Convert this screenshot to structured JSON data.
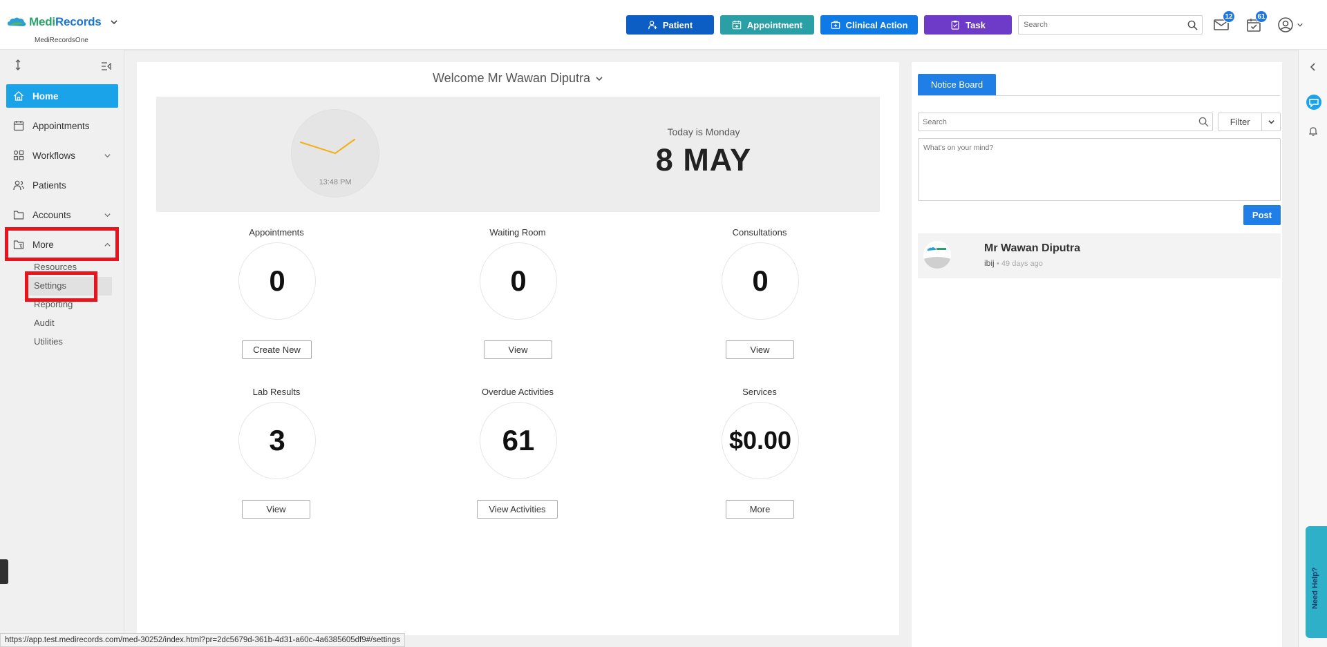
{
  "header": {
    "brand": {
      "name_a": "Medi",
      "name_b": "Records",
      "sub": "MediRecordsOne"
    },
    "buttons": {
      "patient": "Patient",
      "appointment": "Appointment",
      "clinical_action": "Clinical Action",
      "task": "Task"
    },
    "search": {
      "placeholder": "Search"
    },
    "mail_badge": "12",
    "tasks_badge": "61"
  },
  "sidebar": {
    "items": [
      {
        "label": "Home"
      },
      {
        "label": "Appointments"
      },
      {
        "label": "Workflows"
      },
      {
        "label": "Patients"
      },
      {
        "label": "Accounts"
      },
      {
        "label": "More"
      }
    ],
    "more_sub": [
      {
        "label": "Resources"
      },
      {
        "label": "Settings"
      },
      {
        "label": "Reporting"
      },
      {
        "label": "Audit"
      },
      {
        "label": "Utilities"
      }
    ]
  },
  "dashboard": {
    "welcome": "Welcome Mr Wawan Diputra",
    "clock_time": "13:48 PM",
    "today_label": "Today is Monday",
    "today_date": "8 MAY",
    "stats": [
      {
        "label": "Appointments",
        "value": "0",
        "button": "Create New"
      },
      {
        "label": "Waiting Room",
        "value": "0",
        "button": "View"
      },
      {
        "label": "Consultations",
        "value": "0",
        "button": "View"
      },
      {
        "label": "Lab Results",
        "value": "3",
        "button": "View"
      },
      {
        "label": "Overdue Activities",
        "value": "61",
        "button": "View Activities"
      },
      {
        "label": "Services",
        "value": "$0.00",
        "button": "More"
      }
    ]
  },
  "notice_board": {
    "tab": "Notice Board",
    "search_placeholder": "Search",
    "filter_label": "Filter",
    "post_placeholder": "What's on your mind?",
    "post_button": "Post",
    "entries": [
      {
        "author": "Mr Wawan Diputra",
        "text": "ibij",
        "time": "• 49 days ago"
      }
    ]
  },
  "help_tab": "Need Help?",
  "status_url": "https://app.test.medirecords.com/med-30252/index.html?pr=2dc5679d-361b-4d31-a60c-4a6385605df9#/settings",
  "colors": {
    "primary_blue": "#1f7fe6",
    "patient_btn": "#0d5ec4",
    "appointment_btn": "#2a9fa6",
    "clinical_btn": "#0f7ae5",
    "task_btn": "#6e3bc8",
    "nav_active": "#1aa3e8",
    "highlight_red": "#e8131c",
    "brand_green": "#2aa36b"
  },
  "icons": {
    "patient": "user-plus-icon",
    "appointment": "calendar-plus-icon",
    "clinical": "medical-kit-icon",
    "task": "clipboard-icon",
    "mail": "mail-icon",
    "tasks": "calendar-check-icon",
    "user": "user-circle-icon"
  }
}
